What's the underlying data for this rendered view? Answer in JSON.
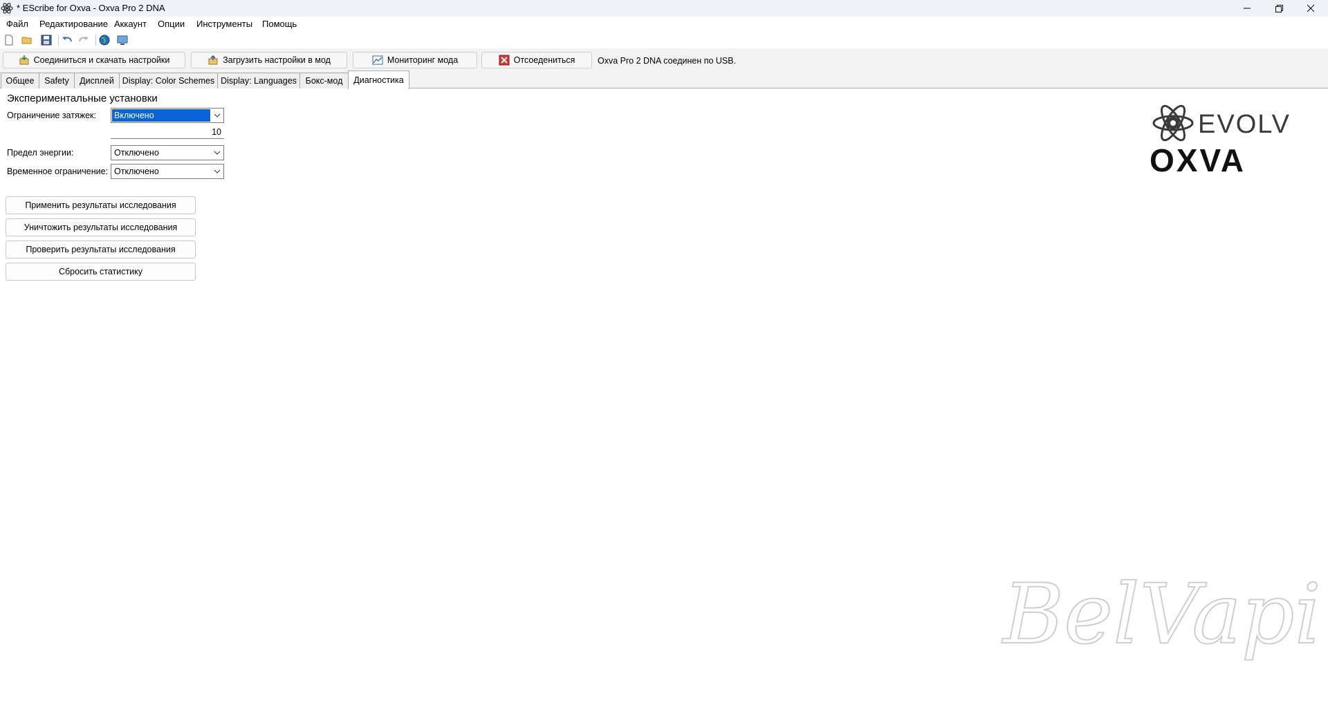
{
  "window": {
    "title": "* EScribe for Oxva - Oxva Pro 2 DNA",
    "controls": [
      "minimize",
      "maximize",
      "close"
    ]
  },
  "menu": {
    "items": [
      "Файл",
      "Редактирование",
      "Аккаунт",
      "Опции",
      "Инструменты",
      "Помощь"
    ]
  },
  "toolbar": {
    "icons": [
      "new-file-icon",
      "open-folder-icon",
      "save-icon",
      "undo-icon",
      "redo-icon",
      "globe-icon",
      "monitor-icon"
    ]
  },
  "actions": {
    "connect_download": "Соединиться и скачать настройки",
    "upload_settings": "Загрузить настройки в мод",
    "monitoring": "Мониторинг мода",
    "disconnect": "Отсоедениться",
    "status": "Oxva Pro 2 DNA соединен по USB."
  },
  "tabs": [
    {
      "label": "Общее",
      "active": false
    },
    {
      "label": "Safety",
      "active": false
    },
    {
      "label": "Дисплей",
      "active": false
    },
    {
      "label": "Display: Color Schemes",
      "active": false
    },
    {
      "label": "Display: Languages",
      "active": false
    },
    {
      "label": "Бокс-мод",
      "active": false
    },
    {
      "label": "Диагностика",
      "active": true
    }
  ],
  "diagnostics": {
    "section_title": "Экспериментальные установки",
    "puff_limit_label": "Ограничение затяжек:",
    "puff_limit_value": "Включено",
    "puff_limit_number": "10",
    "energy_limit_label": "Предел энергии:",
    "energy_limit_value": "Отключено",
    "time_limit_label": "Временное ограничение:",
    "time_limit_value": "Отключено",
    "apply_button": "Применить результаты исследования",
    "destroy_button": "Уничтожить результаты исследования",
    "check_button": "Проверить результаты исследования",
    "reset_button": "Сбросить статистику"
  },
  "branding": {
    "logo_top": "EVOLV",
    "logo_bottom": "OXVA",
    "accent_color": "#e2231a",
    "watermark": "BelVaping"
  }
}
